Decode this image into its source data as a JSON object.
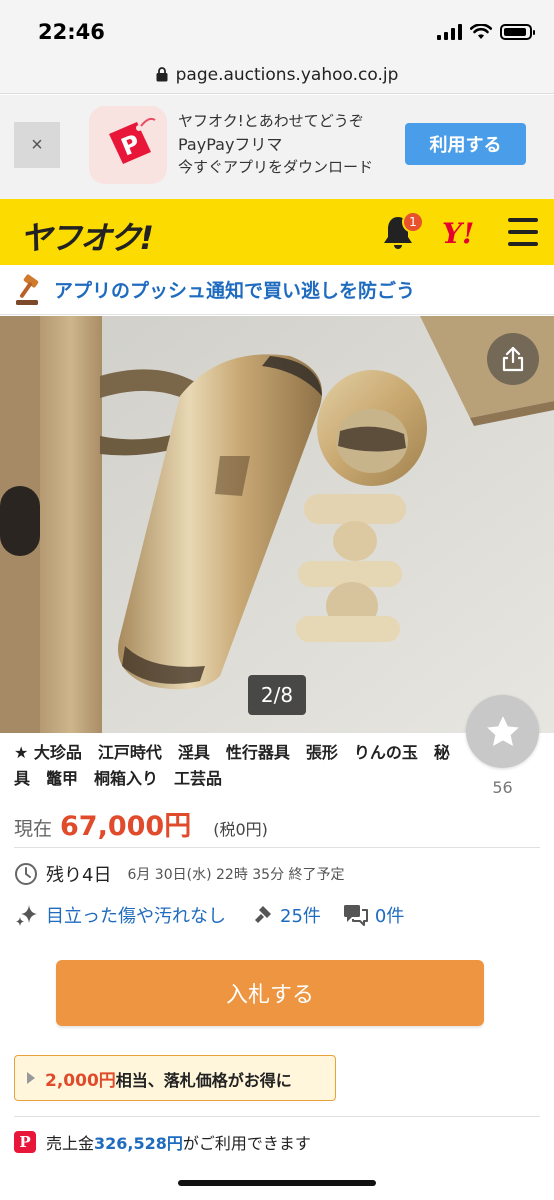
{
  "status_bar": {
    "time": "22:46"
  },
  "url": "page.auctions.yahoo.co.jp",
  "app_banner": {
    "close_label": "×",
    "line1": "ヤフオク!とあわせてどうぞ",
    "line2": "PayPayフリマ",
    "line3": "今すぐアプリをダウンロード",
    "button_label": "利用する"
  },
  "header": {
    "logo": "ヤフオク!",
    "notification_count": "1",
    "yahoo_logo": "Y!"
  },
  "push_banner": {
    "text": "アプリのプッシュ通知で買い逃しを防ごう"
  },
  "photo": {
    "counter": "2/8"
  },
  "item": {
    "title": "★ 大珍品　江戸時代　淫具　性行器具　張形　りんの玉　秘具　鼈甲　桐箱入り　工芸品",
    "watch_count": "56",
    "price_label": "現在",
    "price": "67,000円",
    "tax": "(税0円)",
    "time_left": "残り4日",
    "end_time": "6月 30日(水) 22時 35分 終了予定",
    "condition": "目立った傷や汚れなし",
    "bids": "25件",
    "comments": "0件"
  },
  "bid_button": "入札する",
  "promo": {
    "amount": "2,000円",
    "text": "相当、落札価格がお得に"
  },
  "sales": {
    "prefix": "売上金",
    "amount": "326,528円",
    "suffix": "がご利用できます"
  },
  "colors": {
    "yahoo_yellow": "#fcdb00",
    "price_red": "#e04b2c",
    "link_blue": "#1f6bbf",
    "bid_orange": "#ee9541",
    "banner_blue": "#4a9de8"
  }
}
